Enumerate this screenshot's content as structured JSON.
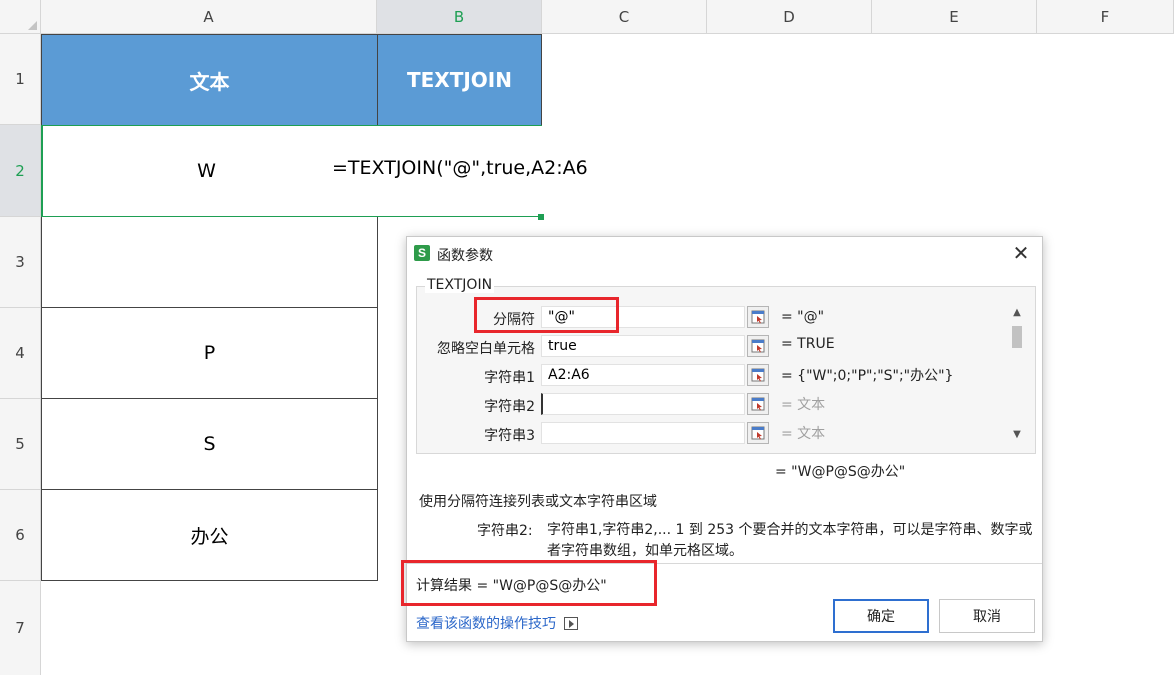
{
  "columns": [
    "A",
    "B",
    "C",
    "D",
    "E",
    "F"
  ],
  "rows": [
    "1",
    "2",
    "3",
    "4",
    "5",
    "6",
    "7"
  ],
  "sheet": {
    "header_a": "文本",
    "header_b": "TEXTJOIN",
    "a2": "W",
    "a4": "P",
    "a5": "S",
    "a6": "办公",
    "formula": "=TEXTJOIN(\"@\",true,A2:A6"
  },
  "dialog": {
    "title": "函数参数",
    "close_glyph": "✕",
    "function_name": "TEXTJOIN",
    "args": [
      {
        "label": "分隔符",
        "value": "\"@\"",
        "result": "= \"@\""
      },
      {
        "label": "忽略空白单元格",
        "value": "true",
        "result": "= TRUE"
      },
      {
        "label": "字符串1",
        "value": "A2:A6",
        "result": "= {\"W\";0;\"P\";\"S\";\"办公\"}"
      },
      {
        "label": "字符串2",
        "value": "",
        "result": "= 文本"
      },
      {
        "label": "字符串3",
        "value": "",
        "result": "= 文本"
      }
    ],
    "total_result": "= \"W@P@S@办公\"",
    "description": "使用分隔符连接列表或文本字符串区域",
    "param_name": "字符串2:",
    "param_description": "字符串1,字符串2,... 1 到 253 个要合并的文本字符串，可以是字符串、数字或者字符串数组，如单元格区域。",
    "calc_result": "计算结果 = \"W@P@S@办公\"",
    "help_link": "查看该函数的操作技巧",
    "ok_label": "确定",
    "cancel_label": "取消"
  },
  "colors": {
    "header_fill": "#5b9bd5",
    "active_green": "#1e9f53",
    "highlight_red": "#e8262c",
    "link_blue": "#2b67c9"
  }
}
